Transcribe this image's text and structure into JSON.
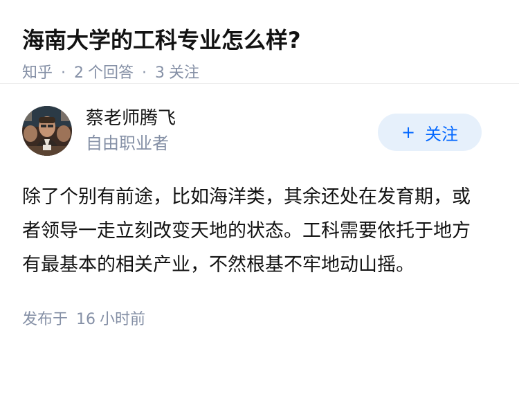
{
  "question": {
    "title": "海南大学的工科专业怎么样?",
    "source": "知乎",
    "answer_count": "2",
    "answer_label": "个回答",
    "follow_count": "3",
    "follow_label": "关注"
  },
  "answer": {
    "author": {
      "name": "蔡老师腾飞",
      "headline": "自由职业者",
      "avatar_icon": "author-avatar-photo"
    },
    "follow_button": {
      "plus": "+",
      "label": "关注"
    },
    "content": "除了个别有前途，比如海洋类，其余还处在发育期，或者领导一走立刻改变天地的状态。工科需要依托于地方有最基本的相关产业，不然根基不牢地动山摇。",
    "time": {
      "prefix": "发布于",
      "value": "16",
      "unit": "小时前"
    }
  },
  "colors": {
    "accent": "#0066ff",
    "follow_bg": "#e6f0fb",
    "meta": "#8590a6",
    "text": "#121212"
  }
}
